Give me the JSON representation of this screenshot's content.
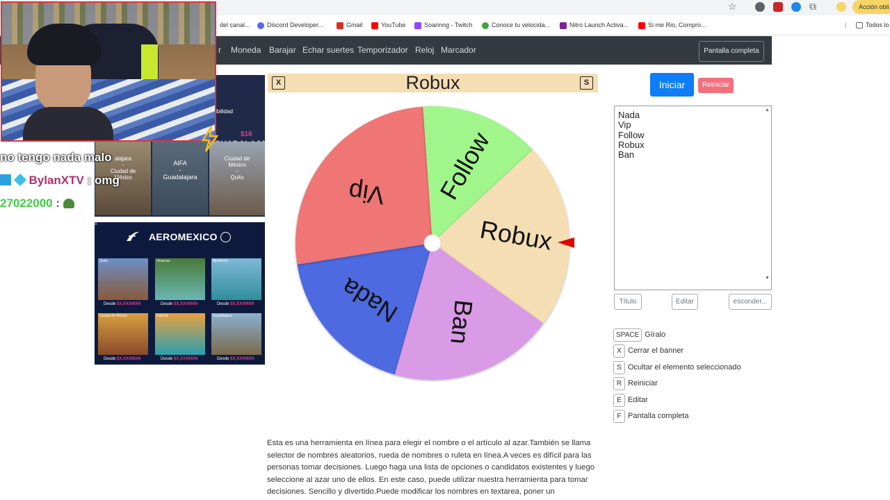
{
  "browser": {
    "bookmarks": [
      {
        "label": "del canal...",
        "color": "#e53935"
      },
      {
        "label": "Discord Developer...",
        "color": "#5865f2"
      },
      {
        "label": "Gmail",
        "color": "#d93025"
      },
      {
        "label": "YouTube",
        "color": "#ff0000"
      },
      {
        "label": "Soarinng - Twitch",
        "color": "#9146ff"
      },
      {
        "label": "Conoce tu velocida...",
        "color": "#43a047"
      },
      {
        "label": "Nitro Launch Activa...",
        "color": "#7b1fa2"
      },
      {
        "label": "Si me Rio, Compro...",
        "color": "#ff0000"
      },
      {
        "label": "Todos lo",
        "color": "#888888"
      }
    ],
    "action_label": "Acción obli",
    "star_icon": "star-icon"
  },
  "nav": {
    "items": [
      "r",
      "Moneda",
      "Barajar",
      "Echar suertes",
      "Temporizador",
      "Reloj",
      "Marcador"
    ],
    "fullscreen": "Pantalla completa"
  },
  "wheel": {
    "title": "Robux",
    "close_key": "X",
    "hide_key": "S",
    "segments": [
      {
        "label": "Nada",
        "color": "#4e6ae0"
      },
      {
        "label": "Vip",
        "color": "#f07474"
      },
      {
        "label": "Follow",
        "color": "#a0f58b"
      },
      {
        "label": "Robux",
        "color": "#f5deb3"
      },
      {
        "label": "Ban",
        "color": "#d99ae6"
      }
    ],
    "pointer_color": "#e00000"
  },
  "controls": {
    "start": "Iniciar",
    "reset": "Reiniciar",
    "names": [
      "Nada",
      "Vip",
      "Follow",
      "Robux",
      "Ban"
    ],
    "title_btn": "Título",
    "edit_btn": "Editar",
    "hide_btn": "esconder..."
  },
  "shortcuts": [
    {
      "key": "SPACE",
      "label": "Gíralo"
    },
    {
      "key": "X",
      "label": "Cerrar el banner"
    },
    {
      "key": "S",
      "label": "Ocultar el elemento seleccionado"
    },
    {
      "key": "R",
      "label": "Reiniciar"
    },
    {
      "key": "E",
      "label": "Editar"
    },
    {
      "key": "F",
      "label": "Pantalla completa"
    }
  ],
  "description": "Esta es una herramienta en línea para elegir el nombre o el artículo al azar.También se llama selector de nombres aleatorios, rueda de nombres o ruleta en línea.A veces es difícil para las personas tomar decisiones. Luego haga una lista de opciones o candidatos existentes y luego seleccione al azar uno de ellos. En este caso, puede utilizar nuestra herramienta para tomar decisiones. Sencillo y divertido.Puede modificar los nombres en textarea, poner un",
  "ad_top": {
    "accessibility": "ibilidad",
    "city_right": "GUADALAJA",
    "price_top": "$16",
    "routes": [
      "alajara\n-\nCiudad de\nMéxico",
      "AIFA\n-\nGuadalajara",
      "Ciudad de\nMéxico\n-\nQuito"
    ]
  },
  "ad_bottom": {
    "brand": "AEROMEXICO",
    "destinations": [
      {
        "name": "Quito",
        "price_label": "Desde",
        "price": "$X,XXXMXN",
        "colors": [
          "#6b8fc7",
          "#8a5a3a"
        ]
      },
      {
        "name": "Veracruz",
        "price_label": "Desde",
        "price": "$X,XXXMXN",
        "colors": [
          "#4a7a3a",
          "#6ab6b0"
        ]
      },
      {
        "name": "Monterrey",
        "price_label": "Desde",
        "price": "$X,XXXMXN",
        "colors": [
          "#7fb8d8",
          "#2f8f9a"
        ]
      },
      {
        "name": "Ciudad de México",
        "price_label": "Desde",
        "price": "$X,XXXMXN",
        "colors": [
          "#d8a040",
          "#8a4a2a"
        ]
      },
      {
        "name": "Cancún",
        "price_label": "Desde",
        "price": "$X,XXXMXN",
        "colors": [
          "#e8a040",
          "#2aa0b0"
        ]
      },
      {
        "name": "Guadalajara",
        "price_label": "Desde",
        "price": "$X,XXXMXN",
        "colors": [
          "#8ab0d0",
          "#7a6a4a"
        ]
      }
    ]
  },
  "chat": [
    {
      "user": "",
      "message": "no tengo nada malo",
      "user_color": "#ffffff",
      "msg_color": "#ffffff"
    },
    {
      "user": "BylanXTV",
      "message": ": omg",
      "user_color": "#b0306a",
      "msg_color": "#ffffff"
    },
    {
      "user": "27022000",
      "message": ":",
      "user_color": "#3ecf3e",
      "msg_color": "#ffffff"
    }
  ]
}
